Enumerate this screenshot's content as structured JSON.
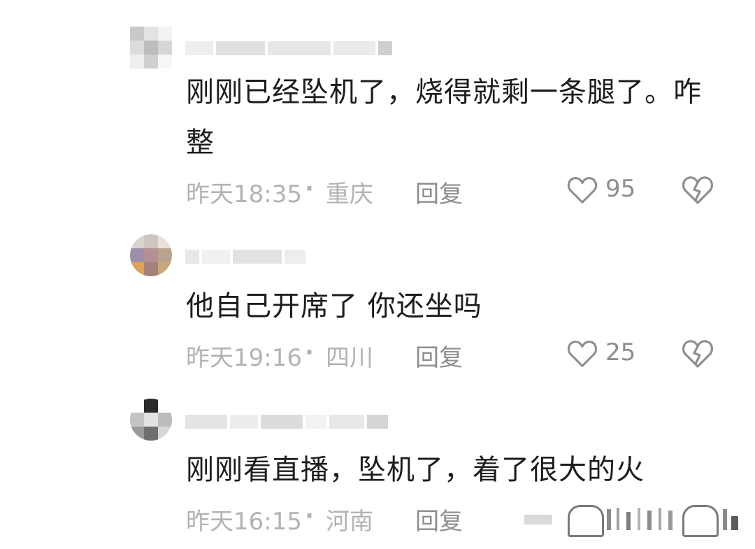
{
  "comments": [
    {
      "text": "刚刚已经坠机了，烧得就剩一条腿了。咋整",
      "time": "昨天18:35",
      "separator": "·",
      "region": "重庆",
      "reply_label": "回复",
      "like_count": "95",
      "like_icon": "heart-outline-icon",
      "dislike_icon": "broken-heart-icon"
    },
    {
      "text": "他自己开席了 你还坐吗",
      "time": "昨天19:16",
      "separator": "·",
      "region": "四川",
      "reply_label": "回复",
      "like_count": "25",
      "like_icon": "heart-outline-icon",
      "dislike_icon": "broken-heart-icon"
    },
    {
      "text": "刚刚看直播，坠机了，着了很大的火",
      "time": "昨天16:15",
      "separator": "·",
      "region": "河南",
      "reply_label": "回复",
      "like_count": "",
      "like_icon": "heart-outline-icon",
      "dislike_icon": "broken-heart-icon"
    }
  ],
  "colors": {
    "text": "#1c1c1c",
    "meta": "#b3b3b3",
    "action": "#8e8e8e",
    "background": "#ffffff"
  }
}
